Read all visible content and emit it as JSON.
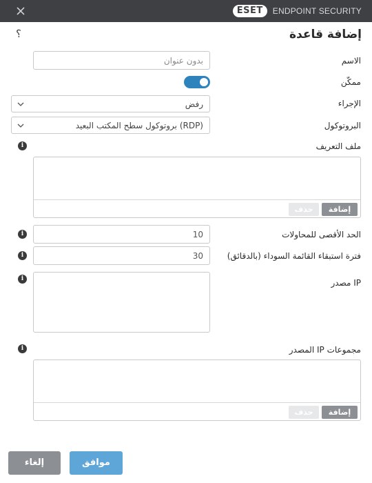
{
  "titlebar": {
    "logo": "ESET",
    "product": "ENDPOINT SECURITY"
  },
  "page": {
    "title": "إضافة قاعدة",
    "help": "؟"
  },
  "form": {
    "name": {
      "label": "الاسم",
      "placeholder": "بدون عنوان"
    },
    "enabled": {
      "label": "ممكّن",
      "value": true
    },
    "action": {
      "label": "الإجراء",
      "value": "رفض"
    },
    "protocol": {
      "label": "البروتوكول",
      "value": "بروتوكول سطح المكتب البعيد (RDP)"
    },
    "profile": {
      "label": "ملف التعريف",
      "add": "إضافة",
      "delete": "حذف"
    },
    "max_attempts": {
      "label": "الحد الأقصى للمحاولات",
      "value": "10"
    },
    "blacklist_period": {
      "label": "فترة استبقاء القائمة السوداء (بالدقائق)",
      "value": "30"
    },
    "source_ip": {
      "label": "IP مصدر"
    },
    "source_ip_groups": {
      "label": "مجموعات IP المصدر",
      "add": "إضافة",
      "delete": "حذف"
    }
  },
  "buttons": {
    "ok": "موافق",
    "cancel": "إلغاء"
  }
}
